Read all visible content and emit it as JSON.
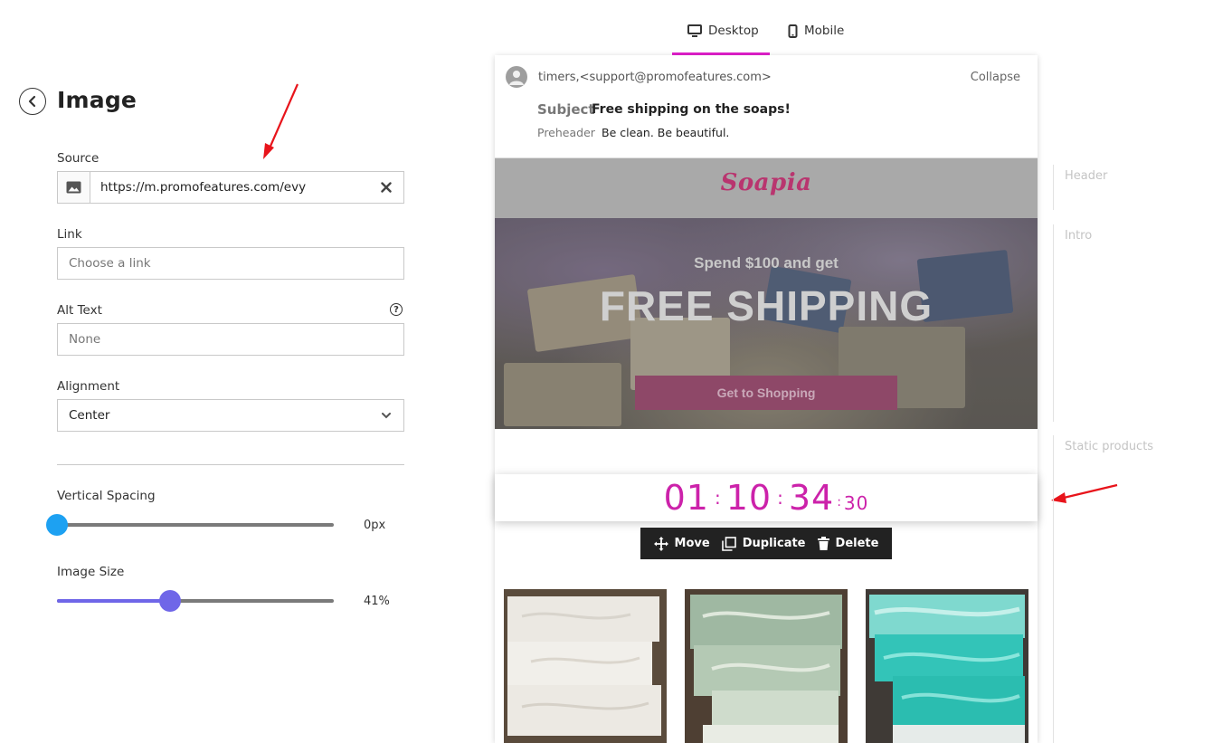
{
  "panel": {
    "title": "Image",
    "source": {
      "label": "Source",
      "value": "https://m.promofeatures.com/evy"
    },
    "link": {
      "label": "Link",
      "placeholder": "Choose a link"
    },
    "alt_text": {
      "label": "Alt Text",
      "placeholder": "None"
    },
    "alignment": {
      "label": "Alignment",
      "value": "Center"
    },
    "vertical_spacing": {
      "label": "Vertical Spacing",
      "value_text": "0px",
      "value": 0,
      "color": "#1da1f2"
    },
    "image_size": {
      "label": "Image Size",
      "value_text": "41%",
      "value": 41,
      "color": "#6f66e8"
    }
  },
  "view_tabs": [
    {
      "label": "Desktop",
      "icon": "desktop-icon",
      "active": true
    },
    {
      "label": "Mobile",
      "icon": "mobile-icon",
      "active": false
    }
  ],
  "email": {
    "sender": "timers,<support@promofeatures.com>",
    "collapse_label": "Collapse",
    "subject_label": "Subject",
    "subject": "Free shipping on the soaps!",
    "preheader_label": "Preheader",
    "preheader": "Be clean. Be beautiful.",
    "logo": "Soapia",
    "hero_pre": "Spend $100 and get",
    "hero_main": "FREE SHIPPING",
    "hero_button": "Get to Shopping",
    "timer": {
      "h": "01",
      "m": "10",
      "s": "34",
      "cs": "30",
      "sep": ":"
    },
    "toolbar": {
      "move": "Move",
      "duplicate": "Duplicate",
      "delete": "Delete"
    }
  },
  "sections": [
    "Header",
    "Intro",
    "Static products"
  ],
  "colors": {
    "accent": "#e21fcc",
    "timer": "#cc22aa",
    "annotation_arrow": "#e8141b"
  }
}
